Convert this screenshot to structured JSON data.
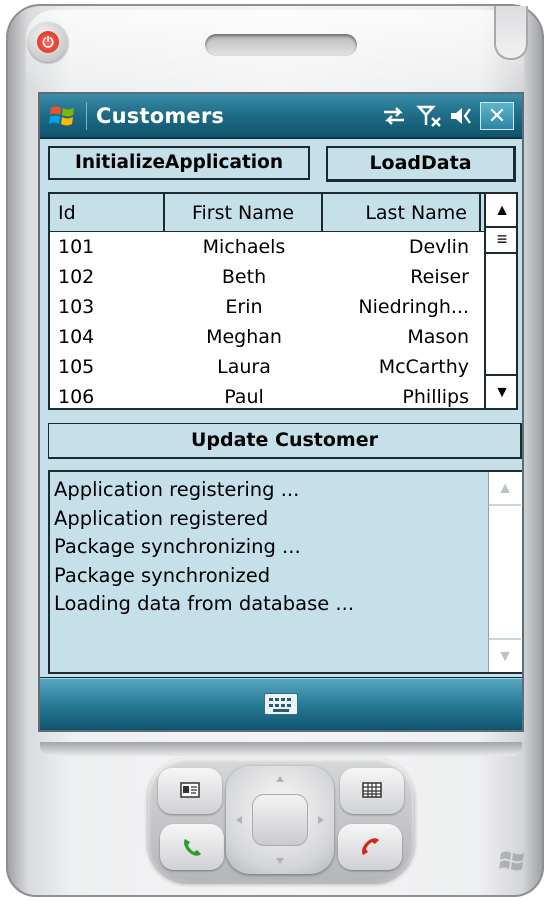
{
  "window": {
    "title": "Customers",
    "close_label": "✕"
  },
  "toolbar": {
    "initialize_label": "InitializeApplication",
    "load_label": "LoadData",
    "update_label": "Update Customer"
  },
  "grid": {
    "columns": [
      "Id",
      "First Name",
      "Last Name"
    ],
    "rows": [
      {
        "id": "101",
        "first": "Michaels",
        "last": "Devlin"
      },
      {
        "id": "102",
        "first": "Beth",
        "last": "Reiser"
      },
      {
        "id": "103",
        "first": "Erin",
        "last": "Niedringh..."
      },
      {
        "id": "104",
        "first": "Meghan",
        "last": "Mason"
      },
      {
        "id": "105",
        "first": "Laura",
        "last": "McCarthy"
      },
      {
        "id": "106",
        "first": "Paul",
        "last": "Phillips"
      }
    ],
    "scroll_up_glyph": "▲",
    "scroll_down_glyph": "▼",
    "scroll_thumb_glyph": "≡"
  },
  "log": {
    "lines": [
      "Application registering ...",
      "Application registered",
      "Package synchronizing ...",
      "Package synchronized",
      "Loading data from database ..."
    ],
    "scroll_up_glyph": "▲",
    "scroll_down_glyph": "▼"
  },
  "power": {
    "glyph": "⏻"
  },
  "icons": {
    "start": "windows-flag-icon",
    "connectivity": "connectivity-arrows-icon",
    "signal": "signal-off-icon",
    "volume": "volume-icon",
    "keyboard": "keyboard-icon"
  },
  "colors": {
    "client_bg": "#c6e0ea",
    "title_bar": "#1f6e8a",
    "power_red": "#d42a1e",
    "call_green": "#2e9b2e",
    "end_red": "#d0261d"
  }
}
